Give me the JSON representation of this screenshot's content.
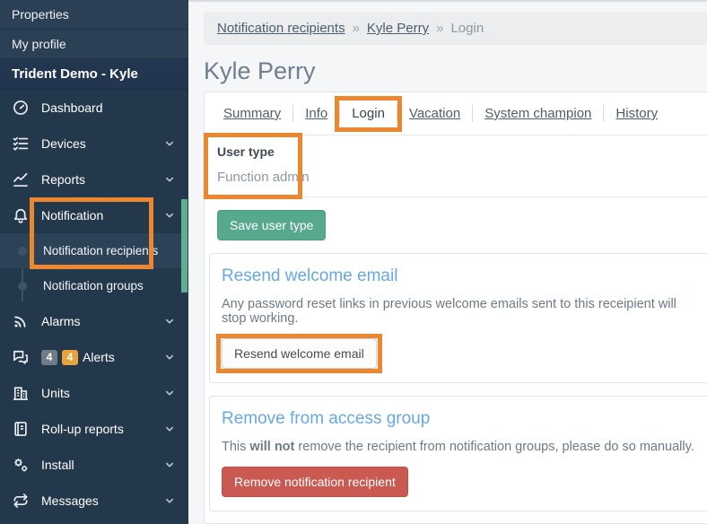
{
  "sidebar": {
    "top_items": [
      {
        "label": "Properties"
      },
      {
        "label": "My profile"
      }
    ],
    "org_header": "Trident Demo - Kyle",
    "nav": [
      {
        "label": "Dashboard",
        "icon": "dashboard-icon",
        "chevron": false
      },
      {
        "label": "Devices",
        "icon": "devices-icon",
        "chevron": true
      },
      {
        "label": "Reports",
        "icon": "reports-icon",
        "chevron": true
      },
      {
        "label": "Notification",
        "icon": "bell-icon",
        "chevron": true,
        "expanded": true,
        "children": [
          {
            "label": "Notification recipients",
            "selected": true
          },
          {
            "label": "Notification groups",
            "selected": false
          }
        ]
      },
      {
        "label": "Alarms",
        "icon": "broadcast-icon",
        "chevron": true
      },
      {
        "label": "Alerts",
        "icon": "chat-bubbles-icon",
        "chevron": true,
        "badges": [
          "4",
          "4"
        ]
      },
      {
        "label": "Units",
        "icon": "building-icon",
        "chevron": true
      },
      {
        "label": "Roll-up reports",
        "icon": "journal-icon",
        "chevron": true
      },
      {
        "label": "Install",
        "icon": "gears-icon",
        "chevron": true
      },
      {
        "label": "Messages",
        "icon": "repeat-arrows-icon",
        "chevron": true
      }
    ]
  },
  "main": {
    "breadcrumb": {
      "separator": "»",
      "items": [
        {
          "label": "Notification recipients",
          "link": true
        },
        {
          "label": "Kyle Perry",
          "link": true
        },
        {
          "label": "Login",
          "link": false
        }
      ]
    },
    "title": "Kyle Perry",
    "tabs": [
      {
        "label": "Summary",
        "active": false
      },
      {
        "label": "Info",
        "active": false
      },
      {
        "label": "Login",
        "active": true
      },
      {
        "label": "Vacation",
        "active": false
      },
      {
        "label": "System champion",
        "active": false
      },
      {
        "label": "History",
        "active": false
      }
    ],
    "user_type": {
      "label": "User type",
      "value": "Function admin"
    },
    "save_button": "Save user type",
    "sections": [
      {
        "heading": "Resend welcome email",
        "body": "Any password reset links in previous welcome emails sent to this receipient will stop working.",
        "button": "Resend welcome email"
      },
      {
        "heading": "Remove from access group",
        "body_prefix": "This ",
        "body_bold": "will not",
        "body_suffix": " remove the recipient from notification groups, please do so manually.",
        "button": "Remove notification recipient"
      }
    ]
  },
  "annotations": [
    "notification-menu",
    "login-tab",
    "user-type-field",
    "resend-welcome-email-button"
  ],
  "colors": {
    "annotation_orange": "#ec862f",
    "sidebar_bg": "#24384c",
    "save_button_green": "#56a98c",
    "remove_button_red": "#ca5952",
    "section_heading_blue": "#66a9e1",
    "alert_badge_gray": "#6f7c88",
    "alert_badge_orange": "#e8a33d",
    "scrollbar_green": "#5fae93"
  }
}
